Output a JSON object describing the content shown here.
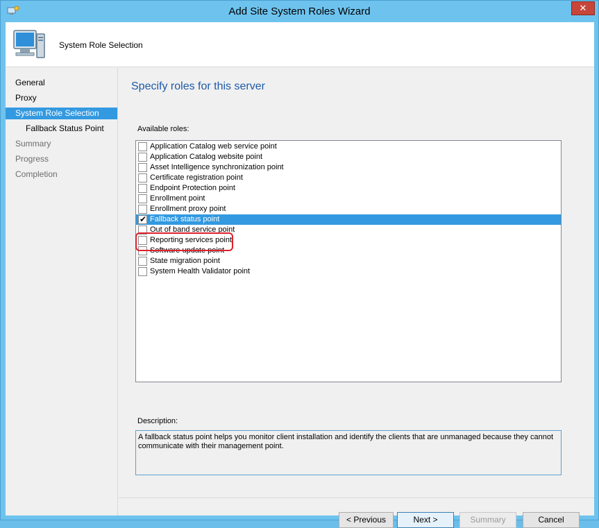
{
  "window": {
    "title": "Add Site System Roles Wizard",
    "close_label": "✕"
  },
  "banner": {
    "title": "System Role Selection"
  },
  "sidebar": {
    "items": [
      {
        "label": "General",
        "state": "normal"
      },
      {
        "label": "Proxy",
        "state": "normal"
      },
      {
        "label": "System Role Selection",
        "state": "active"
      },
      {
        "label": "Fallback Status Point",
        "state": "sub"
      },
      {
        "label": "Summary",
        "state": "disabled"
      },
      {
        "label": "Progress",
        "state": "disabled"
      },
      {
        "label": "Completion",
        "state": "disabled"
      }
    ]
  },
  "main": {
    "heading": "Specify roles for this server",
    "available_label": "Available roles:",
    "roles": [
      {
        "label": "Application Catalog web service point",
        "checked": false,
        "selected": false
      },
      {
        "label": "Application Catalog website point",
        "checked": false,
        "selected": false
      },
      {
        "label": "Asset Intelligence synchronization point",
        "checked": false,
        "selected": false
      },
      {
        "label": "Certificate registration point",
        "checked": false,
        "selected": false
      },
      {
        "label": "Endpoint Protection point",
        "checked": false,
        "selected": false
      },
      {
        "label": "Enrollment point",
        "checked": false,
        "selected": false
      },
      {
        "label": "Enrollment proxy point",
        "checked": false,
        "selected": false
      },
      {
        "label": "Fallback status point",
        "checked": true,
        "selected": true
      },
      {
        "label": "Out of band service point",
        "checked": false,
        "selected": false
      },
      {
        "label": "Reporting services point",
        "checked": false,
        "selected": false
      },
      {
        "label": "Software update point",
        "checked": false,
        "selected": false
      },
      {
        "label": "State migration point",
        "checked": false,
        "selected": false
      },
      {
        "label": "System Health Validator point",
        "checked": false,
        "selected": false
      }
    ],
    "description_label": "Description:",
    "description_text": "A fallback status point helps you monitor client installation and identify the clients that are unmanaged because they cannot communicate with their management point."
  },
  "buttons": {
    "previous": "< Previous",
    "next": "Next >",
    "summary": "Summary",
    "cancel": "Cancel"
  },
  "colors": {
    "accent": "#3399e0",
    "heading": "#1e5aa8",
    "highlight": "#e0202a"
  },
  "icons": {
    "title": "wizard-icon",
    "banner": "computer-monitor-icon",
    "check": "checkmark-icon"
  }
}
